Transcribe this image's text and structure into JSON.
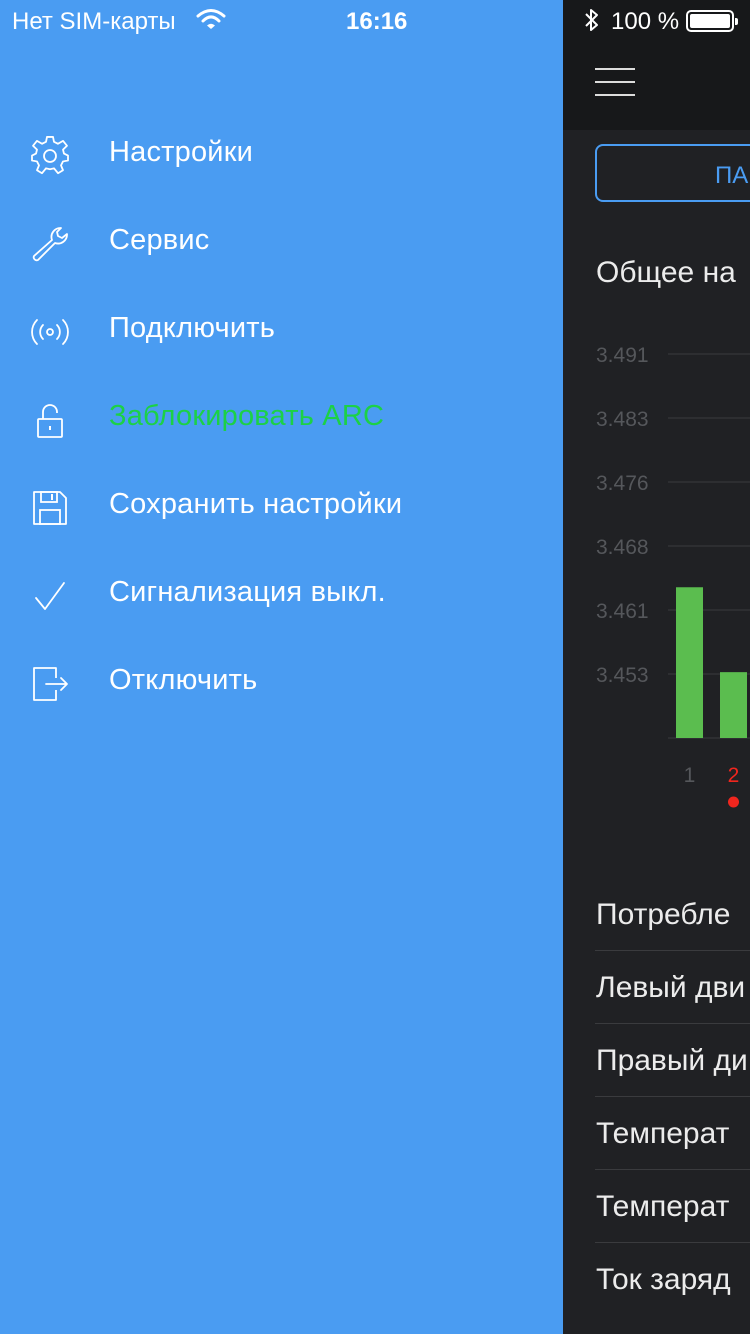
{
  "status_bar": {
    "carrier": "Нет SIM-карты",
    "time": "16:16",
    "battery": "100 %",
    "icons": [
      "wifi-icon",
      "bluetooth-icon",
      "battery-icon"
    ]
  },
  "drawer": {
    "background": "#4a9cf2",
    "items": [
      {
        "label": "Настройки",
        "icon": "gear-icon"
      },
      {
        "label": "Сервис",
        "icon": "wrench-icon"
      },
      {
        "label": "Подключить",
        "icon": "broadcast-icon"
      },
      {
        "label": "Заблокировать ARC",
        "icon": "unlock-icon",
        "color": "#1cd146"
      },
      {
        "label": "Сохранить настройки",
        "icon": "floppy-disk-icon"
      },
      {
        "label": "Сигнализация выкл.",
        "icon": "checkmark-icon"
      },
      {
        "label": "Отключить",
        "icon": "exit-icon"
      }
    ]
  },
  "main": {
    "button_label": "ПА",
    "section_title": "Общее на",
    "list": [
      "Потребле",
      "Левый дви",
      "Правый ди",
      "Температ",
      "Температ",
      "Ток заряд"
    ]
  },
  "chart_data": {
    "type": "bar",
    "categories": [
      "1",
      "2"
    ],
    "values": [
      3.4616,
      3.4509
    ],
    "selected_category": "2",
    "ytick_labels": [
      "3.491",
      "3.483",
      "3.476",
      "3.468",
      "3.461",
      "3.453"
    ],
    "ylim": [
      3.4426,
      3.491
    ],
    "bar_color": "#5bbd4f",
    "selected_color": "#f0261e"
  }
}
